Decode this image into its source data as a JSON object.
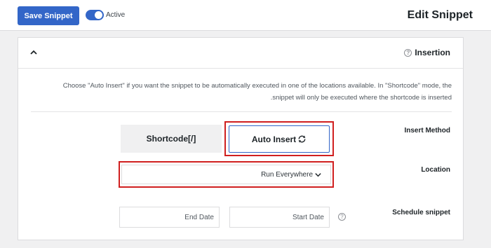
{
  "header": {
    "save_label": "Save Snippet",
    "active_label": "Active",
    "active": true,
    "title": "Edit Snippet"
  },
  "insertion": {
    "title": "Insertion",
    "description_line1": "Choose \"Auto Insert\" if you want the snippet to be automatically executed in one of the locations available. In \"Shortcode\" mode, the",
    "description_line2": ".snippet will only be executed where the shortcode is inserted",
    "insert_method_label": "Insert Method",
    "method_shortcode": "Shortcode[/]",
    "method_auto_insert": "Auto Insert",
    "selected_method": "Auto Insert",
    "location_label": "Location",
    "location_value": "Run Everywhere",
    "schedule_label": "Schedule snippet",
    "start_date_placeholder": "Start Date",
    "end_date_placeholder": "End Date"
  },
  "colors": {
    "accent": "#3366c8",
    "highlight": "#d01f1f"
  },
  "icons": {
    "collapse": "chevron-up-icon",
    "help": "help-icon",
    "refresh": "refresh-icon",
    "dropdown": "chevron-down-icon"
  }
}
